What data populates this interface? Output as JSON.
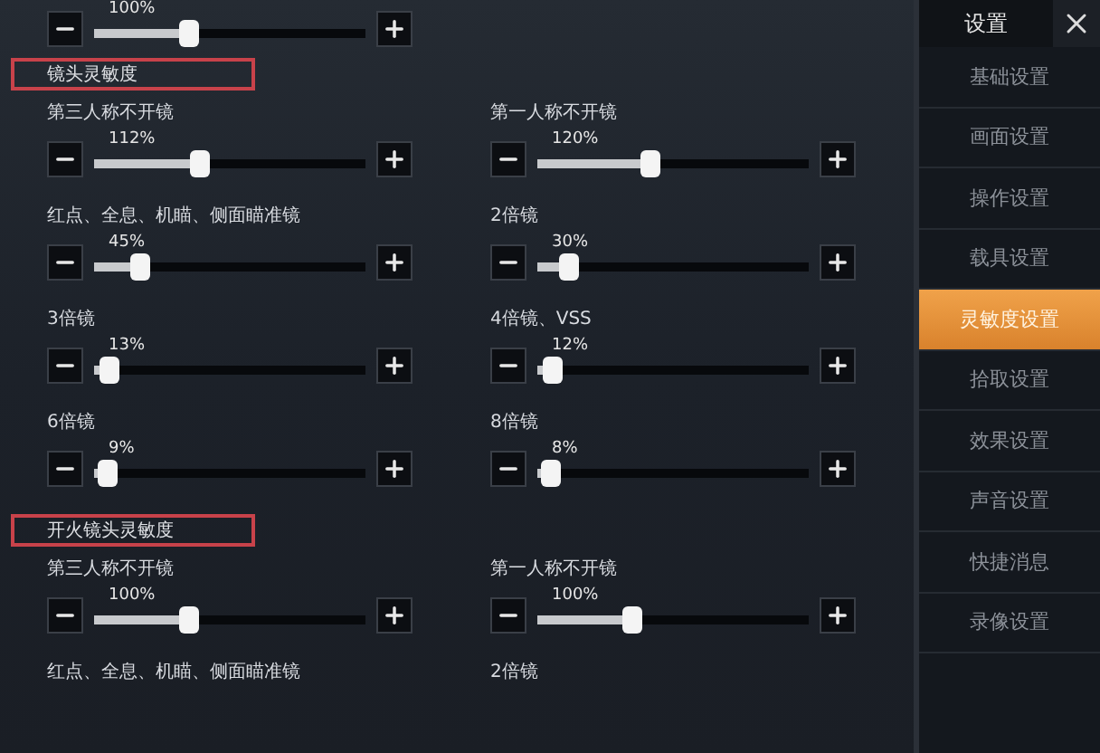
{
  "top_row": [
    {
      "value": "100%",
      "level": 0.33
    }
  ],
  "sections": [
    {
      "title": "镜头灵敏度",
      "highlighted": true,
      "settings": [
        {
          "label": "第三人称不开镜",
          "value": "112%",
          "level": 0.37
        },
        {
          "label": "第一人称不开镜",
          "value": "120%",
          "level": 0.4
        },
        {
          "label": "红点、全息、机瞄、侧面瞄准镜",
          "value": "45%",
          "level": 0.15
        },
        {
          "label": "2倍镜",
          "value": "30%",
          "level": 0.1
        },
        {
          "label": "3倍镜",
          "value": "13%",
          "level": 0.04
        },
        {
          "label": "4倍镜、VSS",
          "value": "12%",
          "level": 0.04
        },
        {
          "label": "6倍镜",
          "value": "9%",
          "level": 0.03
        },
        {
          "label": "8倍镜",
          "value": "8%",
          "level": 0.03
        }
      ]
    },
    {
      "title": "开火镜头灵敏度",
      "highlighted": true,
      "settings": [
        {
          "label": "第三人称不开镜",
          "value": "100%",
          "level": 0.33
        },
        {
          "label": "第一人称不开镜",
          "value": "100%",
          "level": 0.33
        },
        {
          "label": "红点、全息、机瞄、侧面瞄准镜"
        },
        {
          "label": "2倍镜"
        }
      ]
    }
  ],
  "sidebar": {
    "title": "设置",
    "items": [
      {
        "label": "基础设置",
        "selected": false
      },
      {
        "label": "画面设置",
        "selected": false
      },
      {
        "label": "操作设置",
        "selected": false
      },
      {
        "label": "载具设置",
        "selected": false
      },
      {
        "label": "灵敏度设置",
        "selected": true
      },
      {
        "label": "拾取设置",
        "selected": false
      },
      {
        "label": "效果设置",
        "selected": false
      },
      {
        "label": "声音设置",
        "selected": false
      },
      {
        "label": "快捷消息",
        "selected": false
      },
      {
        "label": "录像设置",
        "selected": false
      }
    ]
  }
}
